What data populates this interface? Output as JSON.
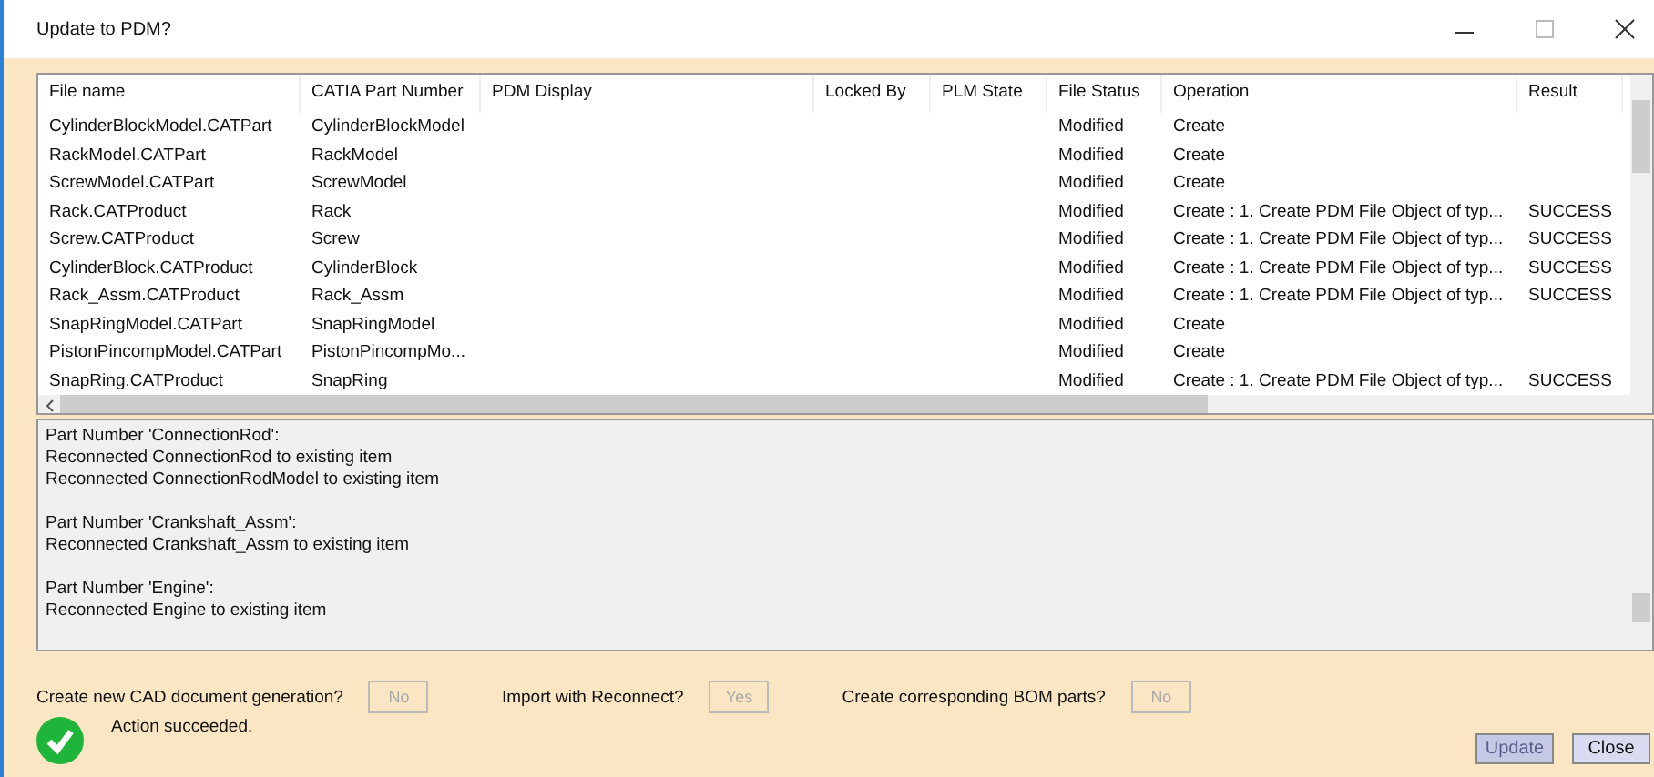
{
  "window": {
    "title": "Update to PDM?"
  },
  "table": {
    "columns": [
      "File name",
      "CATIA Part Number",
      "PDM Display",
      "Locked By",
      "PLM State",
      "File Status",
      "Operation",
      "Result"
    ],
    "rows": [
      [
        "CylinderBlockModel.CATPart",
        "CylinderBlockModel",
        "",
        "",
        "",
        "Modified",
        "Create",
        ""
      ],
      [
        "RackModel.CATPart",
        "RackModel",
        "",
        "",
        "",
        "Modified",
        "Create",
        ""
      ],
      [
        "ScrewModel.CATPart",
        "ScrewModel",
        "",
        "",
        "",
        "Modified",
        "Create",
        ""
      ],
      [
        "Rack.CATProduct",
        "Rack",
        "",
        "",
        "",
        "Modified",
        "Create : 1. Create PDM File Object of typ...",
        "SUCCESS"
      ],
      [
        "Screw.CATProduct",
        "Screw",
        "",
        "",
        "",
        "Modified",
        "Create : 1. Create PDM File Object of typ...",
        "SUCCESS"
      ],
      [
        "CylinderBlock.CATProduct",
        "CylinderBlock",
        "",
        "",
        "",
        "Modified",
        "Create : 1. Create PDM File Object of typ...",
        "SUCCESS"
      ],
      [
        "Rack_Assm.CATProduct",
        "Rack_Assm",
        "",
        "",
        "",
        "Modified",
        "Create : 1. Create PDM File Object of typ...",
        "SUCCESS"
      ],
      [
        "SnapRingModel.CATPart",
        "SnapRingModel",
        "",
        "",
        "",
        "Modified",
        "Create",
        ""
      ],
      [
        "PistonPincompModel.CATPart",
        "PistonPincompMo...",
        "",
        "",
        "",
        "Modified",
        "Create",
        ""
      ],
      [
        "SnapRing.CATProduct",
        "SnapRing",
        "",
        "",
        "",
        "Modified",
        "Create : 1. Create PDM File Object of typ...",
        "SUCCESS"
      ]
    ]
  },
  "log": [
    [
      "Part Number 'ConnectionRod':",
      "Reconnected ConnectionRod to existing item",
      "Reconnected ConnectionRodModel to existing item"
    ],
    [
      "Part Number 'Crankshaft_Assm':",
      "Reconnected Crankshaft_Assm to existing item"
    ],
    [
      "Part Number 'Engine':",
      "Reconnected Engine to existing item"
    ]
  ],
  "options": [
    {
      "label": "Create new CAD document generation?",
      "value": "No",
      "disabled": true
    },
    {
      "label": "Import with Reconnect?",
      "value": "Yes",
      "disabled": true
    },
    {
      "label": "Create corresponding BOM parts?",
      "value": "No",
      "disabled": true
    }
  ],
  "status": "Action succeeded.",
  "buttons": [
    {
      "label": "Update",
      "disabled": true
    },
    {
      "label": "Close",
      "disabled": false
    }
  ]
}
